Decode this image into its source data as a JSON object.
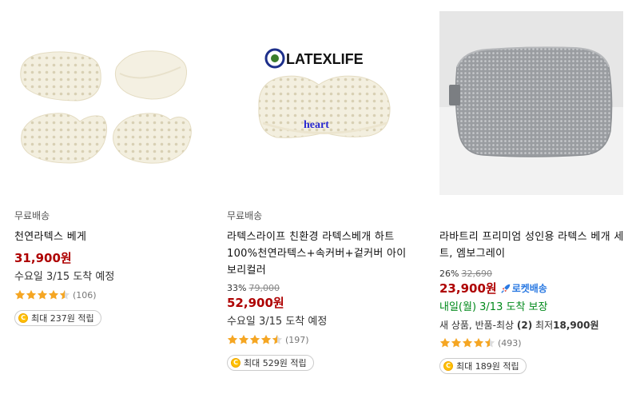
{
  "products": [
    {
      "image_name": "latex-pillow-set-image",
      "shipping": "무료배송",
      "title": "천연라텍스 베게",
      "price": "31,900원",
      "arrival": "수요일 3/15 도착 예정",
      "rating": 4.5,
      "review_count": "(106)",
      "reward": "최대 237원 적립"
    },
    {
      "image_name": "latexlife-pillow-image",
      "image_brand": "LATEXLIFE",
      "image_caption": "heart",
      "shipping": "무료배송",
      "title": "라텍스라이프 친환경 라텍스베개 하트 100%천연라텍스+속커버+겉커버 아이보리컬러",
      "discount": "33%",
      "original_price": "79,000",
      "price": "52,900원",
      "arrival": "수요일 3/15 도착 예정",
      "rating": 4.5,
      "review_count": "(197)",
      "reward": "최대 529원 적립"
    },
    {
      "image_name": "gray-latex-pillow-image",
      "title": "라바트리 프리미엄 성인용 라텍스 베개 세트, 엠보그레이",
      "discount": "26%",
      "original_price": "32,690",
      "price": "23,900원",
      "rocket_label": "로켓배송",
      "arrival": "내일(월) 3/13 도착 보장",
      "new_text": "새 상품, 반품-최상",
      "new_count": "(2)",
      "new_min_label": "최저",
      "new_min_price": "18,900원",
      "rating": 4.5,
      "review_count": "(493)",
      "reward": "최대 189원 적립"
    }
  ],
  "colors": {
    "price": "#ae0000",
    "rocket": "#2a79e2",
    "arrival_green": "#00891a",
    "star": "#f5a623",
    "coin": "#ffc000"
  },
  "icons": {
    "star": "star-icon",
    "rocket": "rocket-icon",
    "coin": "coin-icon"
  }
}
